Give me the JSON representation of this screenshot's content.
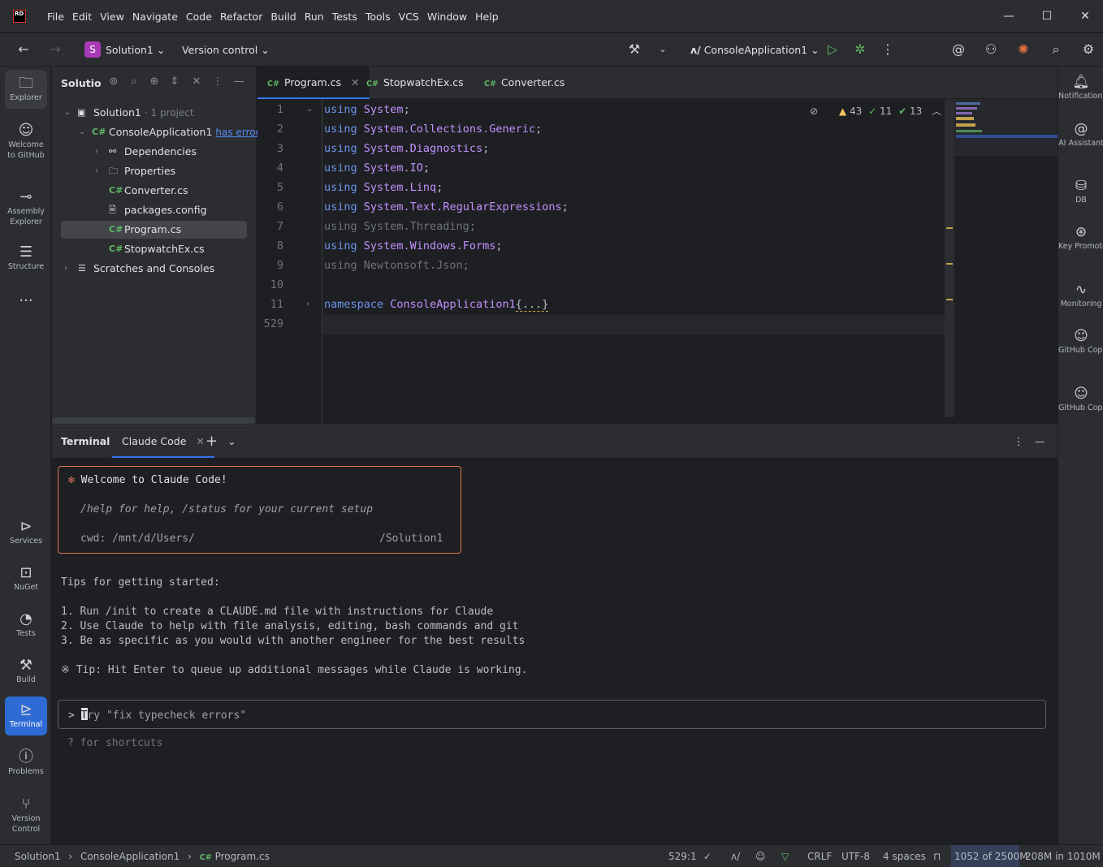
{
  "menu": [
    "File",
    "Edit",
    "View",
    "Navigate",
    "Code",
    "Refactor",
    "Build",
    "Run",
    "Tests",
    "Tools",
    "VCS",
    "Window",
    "Help"
  ],
  "app_logo": "RD",
  "toolbar": {
    "project_initial": "S",
    "project_name": "Solution1",
    "version_control": "Version control",
    "run_config": "ConsoleApplication1"
  },
  "left_strip": [
    {
      "label": "Explorer"
    },
    {
      "label": "Welcome to GitHub"
    },
    {
      "label": "Assembly Explorer"
    },
    {
      "label": "Structure"
    }
  ],
  "left_strip_bottom": [
    {
      "label": "Services"
    },
    {
      "label": "NuGet"
    },
    {
      "label": "Tests"
    },
    {
      "label": "Build"
    },
    {
      "label": "Terminal"
    },
    {
      "label": "Problems"
    },
    {
      "label": "Version Control"
    }
  ],
  "right_strip": [
    {
      "label": "Notifications"
    },
    {
      "label": "AI Assistant"
    },
    {
      "label": "DB"
    },
    {
      "label": "Key Promoter"
    },
    {
      "label": "Monitoring"
    },
    {
      "label": "GitHub Copilot"
    },
    {
      "label": "GitHub Copilot Chat"
    }
  ],
  "solution": {
    "title": "Solutio",
    "tree": [
      {
        "label": "Solution1",
        "suffix": "· 1 project"
      },
      {
        "label": "ConsoleApplication1",
        "link": "has errors"
      },
      {
        "label": "Dependencies"
      },
      {
        "label": "Properties"
      },
      {
        "label": "Converter.cs"
      },
      {
        "label": "packages.config"
      },
      {
        "label": "Program.cs"
      },
      {
        "label": "StopwatchEx.cs"
      },
      {
        "label": "Scratches and Consoles"
      }
    ]
  },
  "editor": {
    "tabs": [
      "Program.cs",
      "StopwatchEx.cs",
      "Converter.cs"
    ],
    "inspections": {
      "warnings": "43",
      "weak": "11",
      "ok": "13"
    },
    "lines": [
      {
        "n": "1",
        "kw": "using",
        "ns": "System",
        "end": ";"
      },
      {
        "n": "2",
        "kw": "using",
        "ns": "System.Collections.Generic",
        "end": ";"
      },
      {
        "n": "3",
        "kw": "using",
        "ns": "System.Diagnostics",
        "end": ";"
      },
      {
        "n": "4",
        "kw": "using",
        "ns": "System.IO",
        "end": ";"
      },
      {
        "n": "5",
        "kw": "using",
        "ns": "System.Linq",
        "end": ";"
      },
      {
        "n": "6",
        "kw": "using",
        "ns": "System.Text.RegularExpressions",
        "end": ";"
      },
      {
        "n": "7",
        "dim": "using System.Threading;"
      },
      {
        "n": "8",
        "kw": "using",
        "ns": "System.Windows.Forms",
        "end": ";"
      },
      {
        "n": "9",
        "dim": "using Newtonsoft.Json;"
      },
      {
        "n": "10"
      },
      {
        "n": "11",
        "kw": "namespace",
        "ns": "ConsoleApplication1",
        "folded": "{...}"
      },
      {
        "n": "529"
      }
    ]
  },
  "terminal": {
    "tabs": [
      "Terminal",
      "Claude Code"
    ],
    "welcome": "Welcome to Claude Code!",
    "help_line": "/help for help, /status for your current setup",
    "cwd_label": "cwd: /mnt/d/Users/",
    "cwd_tail": "/Solution1",
    "tips_title": "Tips for getting started:",
    "tips": [
      "1. Run /init to create a CLAUDE.md file with instructions for Claude",
      "2. Use Claude to help with file analysis, editing, bash commands and git",
      "3. Be as specific as you would with another engineer for the best results"
    ],
    "tip_extra": "※ Tip: Hit Enter to queue up additional messages while Claude is working.",
    "prompt_prefix": ">",
    "prompt_placeholder_first": "T",
    "prompt_placeholder_rest": "ry \"fix typecheck errors\"",
    "shortcuts": "? for shortcuts"
  },
  "status": {
    "breadcrumb": [
      "Solution1",
      "ConsoleApplication1",
      "Program.cs"
    ],
    "position": "529:1",
    "line_ending": "CRLF",
    "encoding": "UTF-8",
    "indent": "4 spaces",
    "memory_used": "1052 of 2500M",
    "memory_extra": "208M in 1010M"
  }
}
